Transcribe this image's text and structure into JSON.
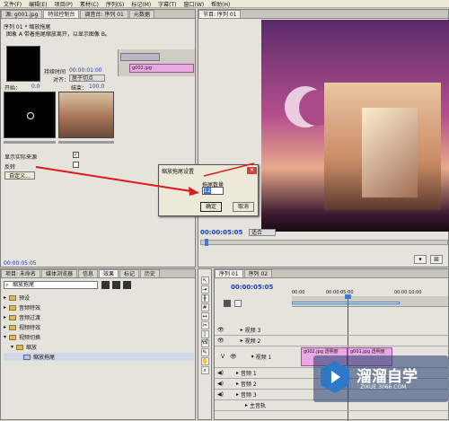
{
  "menu": [
    "文件(F)",
    "编辑(E)",
    "项目(P)",
    "素材(C)",
    "序列(S)",
    "标记(M)",
    "字幕(T)",
    "窗口(W)",
    "帮助(H)"
  ],
  "top_left_tabs": [
    "源: g001.jpg",
    "特效控制台",
    "调音台: 序列 01",
    "元数据"
  ],
  "effect_controls": {
    "sequence": "序列 01 * 缩放拖尾",
    "clip_name": "g002.jpg",
    "description": "图象 A 带着拖尾缩放离开，以显示图像 B。",
    "duration_label": "持续时间",
    "duration_value": "00:00:01:00",
    "align_label": "对齐：",
    "align_value": "居于切点",
    "start_label": "开始：",
    "start_value": "0.0",
    "end_label": "结束：",
    "end_value": "100.0",
    "show_source_label": "显示实际来源",
    "reverse_label": "反转",
    "custom_button": "自定义...",
    "clip_a": "g001.jpg",
    "time_bottom": "00:00:05:05"
  },
  "program": {
    "tabs": [
      "节目: 序列 01"
    ],
    "timecode": "00:00:05:05",
    "fit": "适合"
  },
  "dialog": {
    "title": "缩放拖尾设置",
    "field_label": "拖尾数量",
    "field_value": "12",
    "ok": "确定",
    "cancel": "取消"
  },
  "project": {
    "tabs": [
      "项目: 未命名",
      "媒体浏览器",
      "信息",
      "效果",
      "标记",
      "历史"
    ],
    "search": "缩放拖尾",
    "items": [
      "预设",
      "音频特效",
      "音频过渡",
      "视频特效",
      "视频切换",
      "缩放",
      "缩放拖尾"
    ]
  },
  "timeline": {
    "tabs": [
      "序列 01",
      "序列 02"
    ],
    "timecode": "00:00:05:05",
    "ruler": [
      "00:00",
      "00:00:05:00",
      "00:00:10:00"
    ],
    "tracks": [
      "视频 3",
      "视频 2",
      "视频 1",
      "音频 1",
      "音频 2",
      "音频 3",
      "主音轨"
    ],
    "clip1": "g002.jpg 透明度",
    "clip2": "g001.jpg 透明度",
    "v_label": "V"
  },
  "watermark": {
    "title": "溜溜自学",
    "url": "ZIXUE.3066.COM"
  }
}
